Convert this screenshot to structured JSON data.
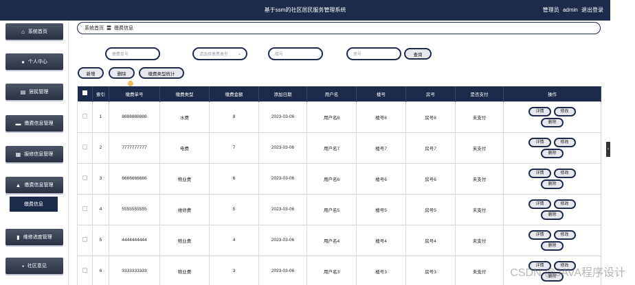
{
  "header": {
    "title": "基于ssm的社区居民服务管理系统",
    "user_role": "管理员",
    "user_name": "admin",
    "logout": "退出登录"
  },
  "sidebar": {
    "items": [
      {
        "label": "系统首页",
        "icon": "home-icon",
        "glyph": "⌂"
      },
      {
        "label": "个人中心",
        "icon": "user-icon",
        "glyph": "●"
      },
      {
        "label": "居民管理",
        "icon": "list-icon",
        "glyph": "▤"
      },
      {
        "label": "缴费信息管理",
        "icon": "wallet-icon",
        "glyph": "▬"
      },
      {
        "label": "报修信息管理",
        "icon": "grid-icon",
        "glyph": "▦"
      },
      {
        "label": "缴费信息管理",
        "icon": "bank-icon",
        "glyph": "▲"
      },
      {
        "label": "维修进度管理",
        "icon": "chart-icon",
        "glyph": "▮"
      },
      {
        "label": "社区意见",
        "icon": "apps-icon",
        "glyph": "▪"
      }
    ],
    "active_sub": "缴费信息"
  },
  "breadcrumb": {
    "home": "系统首页",
    "separator": "〓",
    "current": "缴费信息"
  },
  "search": {
    "fee_no_placeholder": "缴费单号",
    "fee_type_placeholder": "请选择缴费类型",
    "building_placeholder": "楼号",
    "room_placeholder": "房号",
    "query_label": "查询"
  },
  "toolbar": {
    "add": "新增",
    "delete": "删除",
    "stats": "缴费类型统计"
  },
  "table": {
    "headers": [
      "索引",
      "缴费单号",
      "缴费类型",
      "缴费金额",
      "添加日期",
      "用户名",
      "楼号",
      "房号",
      "是否支付",
      "操作"
    ],
    "rows": [
      {
        "index": "1",
        "no": "8888888888",
        "type": "水费",
        "amount": "8",
        "date": "2023-03-06",
        "user": "用户名8",
        "building": "楼号8",
        "room": "房号8",
        "paid": "未支付"
      },
      {
        "index": "2",
        "no": "7777777777",
        "type": "电费",
        "amount": "7",
        "date": "2023-03-06",
        "user": "用户名7",
        "building": "楼号7",
        "room": "房号7",
        "paid": "未支付"
      },
      {
        "index": "3",
        "no": "6666666666",
        "type": "物业费",
        "amount": "6",
        "date": "2023-03-06",
        "user": "用户名6",
        "building": "楼号6",
        "room": "房号6",
        "paid": "未支付"
      },
      {
        "index": "4",
        "no": "5555555555",
        "type": "维修费",
        "amount": "5",
        "date": "2023-03-06",
        "user": "用户名5",
        "building": "楼号5",
        "room": "房号5",
        "paid": "未支付"
      },
      {
        "index": "5",
        "no": "4444444444",
        "type": "物业费",
        "amount": "4",
        "date": "2023-03-06",
        "user": "用户名4",
        "building": "楼号4",
        "room": "房号4",
        "paid": "未支付"
      },
      {
        "index": "6",
        "no": "3333333333",
        "type": "物业费",
        "amount": "3",
        "date": "2023-03-06",
        "user": "用户名3",
        "building": "楼号3",
        "room": "房号3",
        "paid": "未支付"
      }
    ],
    "actions": {
      "detail": "详情",
      "edit": "修改",
      "delete": "删除"
    }
  },
  "watermark": "CSDN @JAVA程序设计",
  "colors": {
    "primary": "#1e2a4c",
    "button_bg": "#e6e8ee"
  }
}
